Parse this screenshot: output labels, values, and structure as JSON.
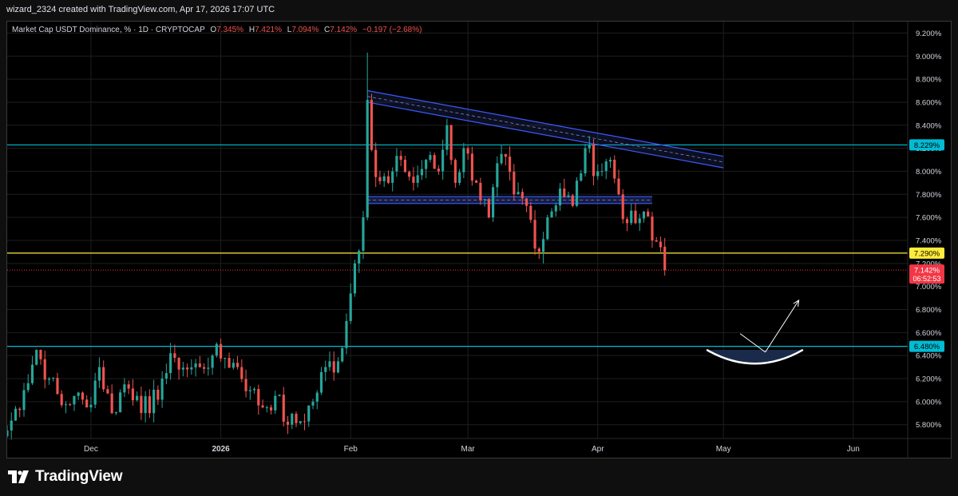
{
  "header": {
    "attribution": "wizard_2324 created with TradingView.com, Apr 17, 2026 17:07 UTC"
  },
  "legend": {
    "symbol": "Market Cap USDT Dominance, % · 1D · CRYPTOCAP",
    "o_label": "O",
    "o_value": "7.345%",
    "h_label": "H",
    "h_value": "7.421%",
    "l_label": "L",
    "l_value": "7.094%",
    "c_label": "C",
    "c_value": "7.142%",
    "change": "−0.197 (−2.68%)"
  },
  "footer": {
    "brand": "TradingView"
  },
  "colors": {
    "up": "#26a69a",
    "down": "#ef5350",
    "background": "#000000",
    "grid": "#1e1e1e",
    "cyan_line": "#00bcd4",
    "yellow_line": "#ffeb3b",
    "channel": "#3f51b5",
    "text": "#d1d4dc"
  },
  "chart_data": {
    "type": "candlestick",
    "title": "Market Cap USDT Dominance, % · 1D · CRYPTOCAP",
    "ylabel": "%",
    "y_range": [
      5.68,
      9.3
    ],
    "x_range": [
      "2025-11-11",
      "2026-06-14"
    ],
    "y_ticks": [
      "9.200%",
      "9.000%",
      "8.800%",
      "8.600%",
      "8.400%",
      "8.200%",
      "8.000%",
      "7.800%",
      "7.600%",
      "7.400%",
      "7.200%",
      "7.000%",
      "6.800%",
      "6.600%",
      "6.400%",
      "6.200%",
      "6.000%",
      "5.800%"
    ],
    "y_tick_values": [
      9.2,
      9.0,
      8.8,
      8.6,
      8.4,
      8.2,
      8.0,
      7.8,
      7.6,
      7.4,
      7.2,
      7.0,
      6.8,
      6.6,
      6.4,
      6.2,
      6.0,
      5.8
    ],
    "x_ticks": [
      {
        "date": "2025-12-01",
        "label": "Dec"
      },
      {
        "date": "2026-01-01",
        "label": "2026"
      },
      {
        "date": "2026-02-01",
        "label": "Feb"
      },
      {
        "date": "2026-03-01",
        "label": "Mar"
      },
      {
        "date": "2026-04-01",
        "label": "Apr"
      },
      {
        "date": "2026-05-01",
        "label": "May"
      },
      {
        "date": "2026-06-01",
        "label": "Jun"
      }
    ],
    "anchor_points": [
      {
        "date": "2025-11-11",
        "close": 5.75
      },
      {
        "date": "2025-11-15",
        "close": 6.1
      },
      {
        "date": "2025-11-18",
        "close": 6.45
      },
      {
        "date": "2025-11-21",
        "close": 6.2
      },
      {
        "date": "2025-11-24",
        "close": 5.97
      },
      {
        "date": "2025-11-27",
        "close": 6.05
      },
      {
        "date": "2025-11-30",
        "close": 5.95
      },
      {
        "date": "2025-12-03",
        "close": 6.3
      },
      {
        "date": "2025-12-06",
        "close": 5.9
      },
      {
        "date": "2025-12-09",
        "close": 6.15
      },
      {
        "date": "2025-12-12",
        "close": 6.05
      },
      {
        "date": "2025-12-15",
        "close": 5.9
      },
      {
        "date": "2025-12-18",
        "close": 6.2
      },
      {
        "date": "2025-12-21",
        "close": 6.38
      },
      {
        "date": "2025-12-24",
        "close": 6.28
      },
      {
        "date": "2025-12-27",
        "close": 6.3
      },
      {
        "date": "2025-12-30",
        "close": 6.4
      },
      {
        "date": "2026-01-02",
        "close": 6.38
      },
      {
        "date": "2026-01-05",
        "close": 6.3
      },
      {
        "date": "2026-01-08",
        "close": 6.1
      },
      {
        "date": "2026-01-11",
        "close": 5.95
      },
      {
        "date": "2026-01-14",
        "close": 6.05
      },
      {
        "date": "2026-01-17",
        "close": 5.8
      },
      {
        "date": "2026-01-20",
        "close": 5.83
      },
      {
        "date": "2026-01-23",
        "close": 6.0
      },
      {
        "date": "2026-01-26",
        "close": 6.3
      },
      {
        "date": "2026-01-29",
        "close": 6.35
      },
      {
        "date": "2026-01-31",
        "close": 6.7
      },
      {
        "date": "2026-02-02",
        "close": 7.2
      },
      {
        "date": "2026-02-04",
        "close": 7.6
      },
      {
        "date": "2026-02-05",
        "close": 8.62
      },
      {
        "date": "2026-02-07",
        "close": 7.95
      },
      {
        "date": "2026-02-10",
        "close": 7.9
      },
      {
        "date": "2026-02-13",
        "close": 8.1
      },
      {
        "date": "2026-02-16",
        "close": 7.9
      },
      {
        "date": "2026-02-19",
        "close": 8.1
      },
      {
        "date": "2026-02-22",
        "close": 8.0
      },
      {
        "date": "2026-02-24",
        "close": 8.4
      },
      {
        "date": "2026-02-26",
        "close": 7.9
      },
      {
        "date": "2026-02-28",
        "close": 8.2
      },
      {
        "date": "2026-03-03",
        "close": 7.9
      },
      {
        "date": "2026-03-06",
        "close": 7.6
      },
      {
        "date": "2026-03-09",
        "close": 8.15
      },
      {
        "date": "2026-03-12",
        "close": 7.8
      },
      {
        "date": "2026-03-15",
        "close": 7.7
      },
      {
        "date": "2026-03-18",
        "close": 7.3
      },
      {
        "date": "2026-03-20",
        "close": 7.6
      },
      {
        "date": "2026-03-23",
        "close": 7.85
      },
      {
        "date": "2026-03-26",
        "close": 7.7
      },
      {
        "date": "2026-03-29",
        "close": 8.2
      },
      {
        "date": "2026-04-01",
        "close": 8.0
      },
      {
        "date": "2026-04-04",
        "close": 8.1
      },
      {
        "date": "2026-04-06",
        "close": 7.8
      },
      {
        "date": "2026-04-08",
        "close": 7.55
      },
      {
        "date": "2026-04-10",
        "close": 7.55
      },
      {
        "date": "2026-04-12",
        "close": 7.65
      },
      {
        "date": "2026-04-14",
        "close": 7.4
      },
      {
        "date": "2026-04-16",
        "close": 7.34
      },
      {
        "date": "2026-04-17",
        "close": 7.142
      }
    ],
    "last_candle": {
      "date": "2026-04-17",
      "open": 7.345,
      "high": 7.421,
      "low": 7.094,
      "close": 7.142
    },
    "notable_wicks": [
      {
        "date": "2026-02-05",
        "high": 9.03
      },
      {
        "date": "2026-03-19",
        "low": 7.2
      }
    ],
    "horizontal_levels": [
      {
        "value": 8.229,
        "label": "8.229%",
        "color": "#00bcd4"
      },
      {
        "value": 7.29,
        "label": "7.290%",
        "color": "#ffeb3b"
      },
      {
        "value": 6.48,
        "label": "6.480%",
        "color": "#00bcd4"
      }
    ],
    "price_label": {
      "value": 7.142,
      "label": "7.142%",
      "countdown": "06:52:53",
      "color": "#f23645"
    },
    "descending_channel": {
      "start": {
        "date": "2026-02-05",
        "top": 8.7,
        "bottom": 8.6
      },
      "end": {
        "date": "2026-05-01",
        "top": 8.13,
        "bottom": 8.03
      }
    },
    "support_band": {
      "from": "2026-02-05",
      "to": "2026-04-14",
      "top": 7.78,
      "bottom": 7.72
    },
    "projection": {
      "arc": {
        "from": "2026-04-27",
        "to": "2026-05-20",
        "level": 6.45,
        "bottom": 6.33
      },
      "arrow_down": {
        "from": {
          "date": "2026-05-05",
          "value": 6.59
        },
        "to": {
          "date": "2026-05-11",
          "value": 6.43
        }
      },
      "arrow_up": {
        "from": {
          "date": "2026-05-11",
          "value": 6.43
        },
        "to": {
          "date": "2026-05-19",
          "value": 6.88
        }
      }
    }
  }
}
